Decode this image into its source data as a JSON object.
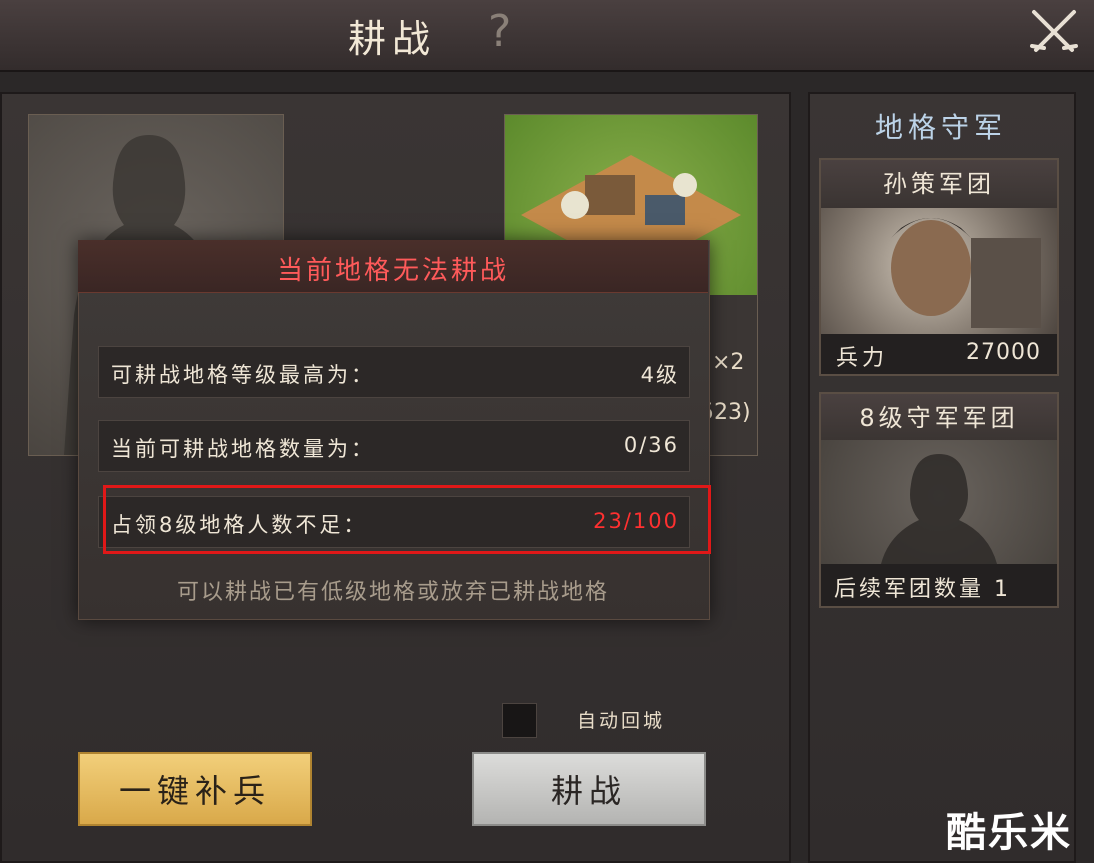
{
  "header": {
    "title": "耕战",
    "help_glyph": "?",
    "close_icon": "crossed-swords-icon"
  },
  "background_panel": {
    "resource_multiplier": "×2",
    "partial_number": "523)"
  },
  "modal": {
    "title": "当前地格无法耕战",
    "rows": [
      {
        "label": "可耕战地格等级最高为：",
        "value": "4级"
      },
      {
        "label": "当前可耕战地格数量为：",
        "value": "0/36"
      },
      {
        "label": "占领8级地格人数不足：",
        "value": "23/100"
      }
    ],
    "hint": "可以耕战已有低级地格或放弃已耕战地格"
  },
  "controls": {
    "auto_return_label": "自动回城",
    "auto_return_checked": false,
    "replenish_button": "一键补兵",
    "farm_button": "耕战"
  },
  "side": {
    "title": "地格守军",
    "cards": [
      {
        "name": "孙策军团",
        "troop_label": "兵力",
        "troop_value": "27000"
      },
      {
        "name": "8级守军军团",
        "footer": "后续军团数量 1"
      }
    ]
  },
  "watermark": "酷乐米",
  "colors": {
    "alert_red": "#ff3030",
    "title_red": "#ff5a5a",
    "highlight_box": "#e01818",
    "gold_button": "#e8bd5e",
    "gray_button": "#c8c8c6",
    "side_title_blue": "#bcd3e8"
  }
}
